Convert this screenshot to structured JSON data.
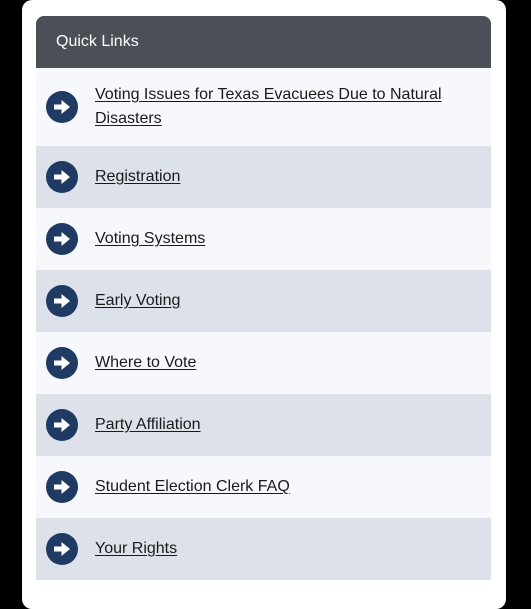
{
  "quick_links": {
    "title": "Quick Links",
    "icon": "arrow-right-circle-icon",
    "colors": {
      "header_bg": "#4a4f58",
      "icon_circle": "#1f3a63",
      "row_light": "#f7f8fc",
      "row_dark": "#dde1ea"
    },
    "items": [
      {
        "label": "Voting Issues for Texas Evacuees Due to Natural Disasters"
      },
      {
        "label": "Registration"
      },
      {
        "label": "Voting Systems"
      },
      {
        "label": "Early Voting"
      },
      {
        "label": "Where to Vote"
      },
      {
        "label": "Party Affiliation"
      },
      {
        "label": "Student Election Clerk FAQ"
      },
      {
        "label": "Your Rights"
      }
    ]
  }
}
